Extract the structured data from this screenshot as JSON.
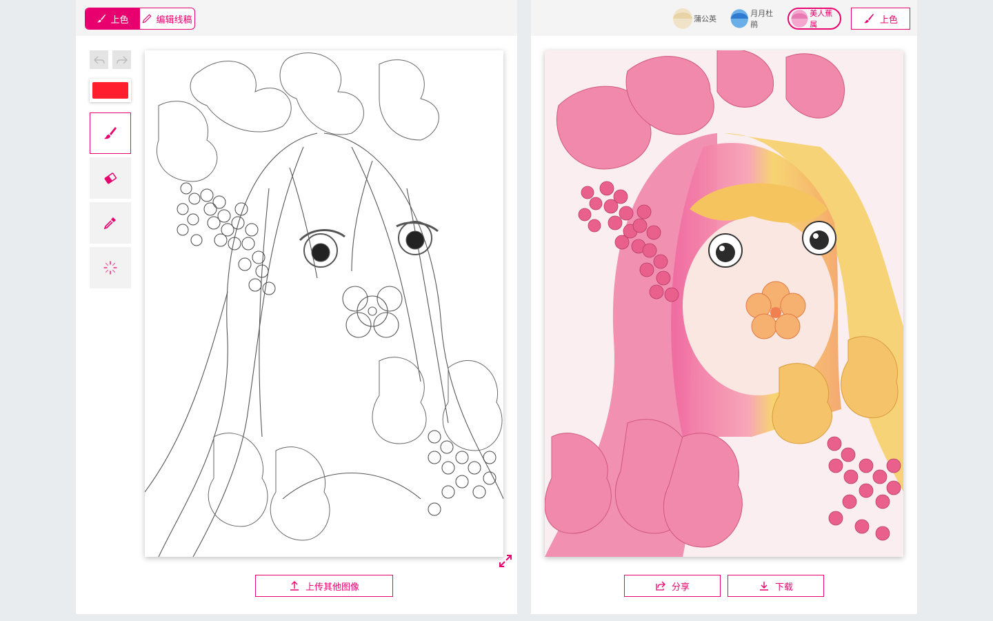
{
  "modes": [
    {
      "label": "上色",
      "icon": "brush-icon",
      "active": true
    },
    {
      "label": "编辑线稿",
      "icon": "pencil-icon",
      "active": false
    }
  ],
  "tools": {
    "undo_icon": "undo-icon",
    "redo_icon": "redo-icon",
    "current_color": "#ff1e2e",
    "items": [
      {
        "name": "brush",
        "icon": "brush-icon",
        "active": true
      },
      {
        "name": "eraser",
        "icon": "eraser-icon",
        "active": false
      },
      {
        "name": "eyedropper",
        "icon": "eyedropper-icon",
        "active": false
      },
      {
        "name": "spinner",
        "icon": "loading-spinner-icon",
        "active": false
      }
    ]
  },
  "upload_button": {
    "label": "上传其他图像",
    "icon": "upload-icon"
  },
  "styles": [
    {
      "label": "蒲公英",
      "active": false
    },
    {
      "label": "月月杜鹃",
      "active": false
    },
    {
      "label": "美人蕉属",
      "active": true
    }
  ],
  "colorize_button": {
    "label": "上色",
    "icon": "brush-icon"
  },
  "share_button": {
    "label": "分享",
    "icon": "share-icon"
  },
  "download_button": {
    "label": "下载",
    "icon": "download-icon"
  },
  "colors": {
    "accent": "#e8006e",
    "background": "#e9ecef",
    "header": "#f4f4f4"
  }
}
